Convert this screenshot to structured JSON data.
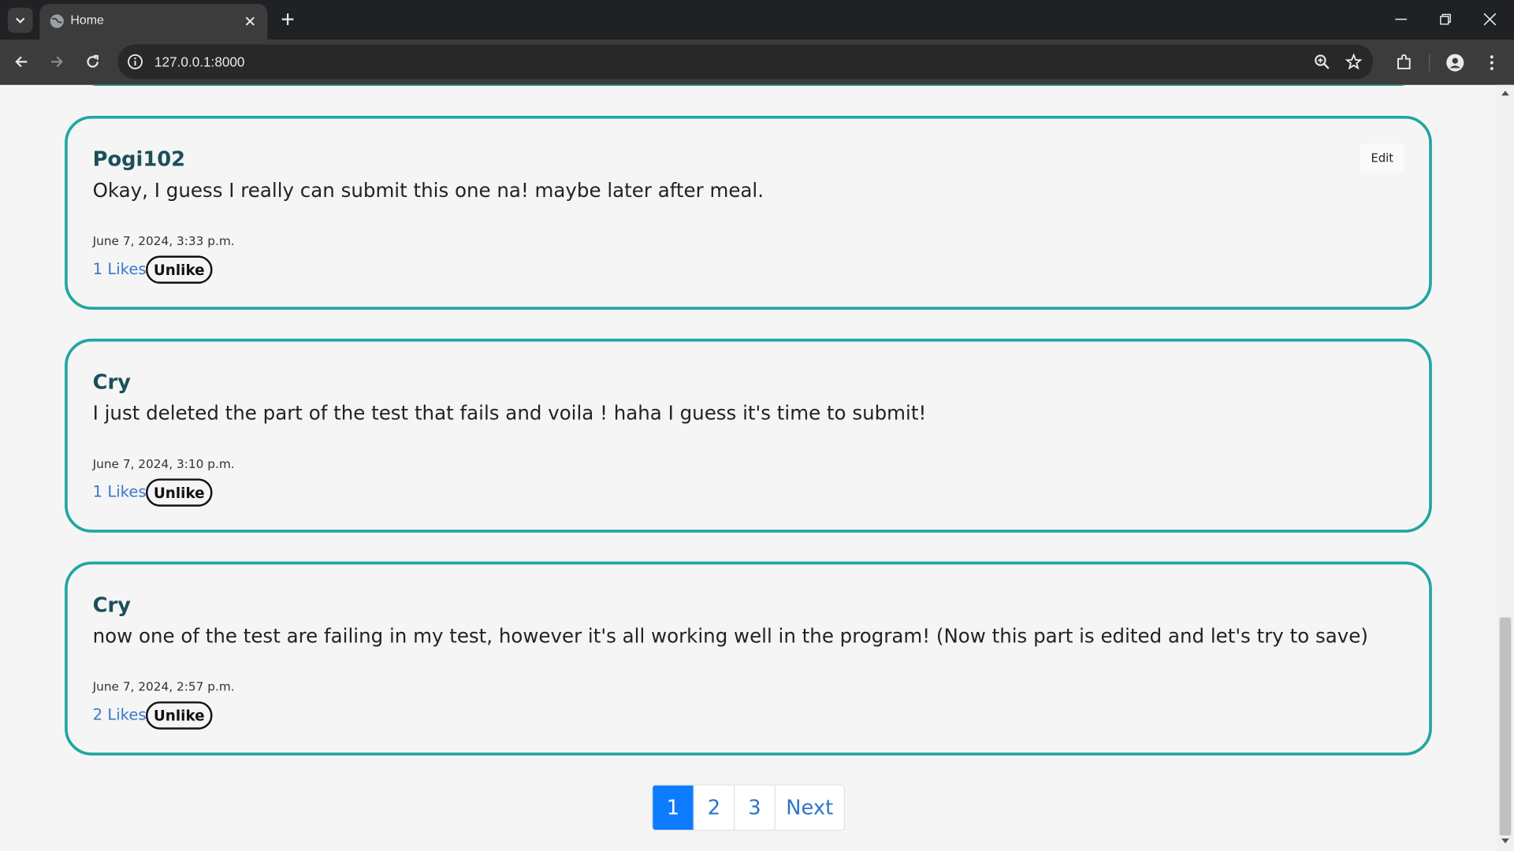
{
  "browser": {
    "tab_title": "Home",
    "url": "127.0.0.1:8000"
  },
  "posts": [
    {
      "author": "Pogi102",
      "body": "Okay, I guess I really can submit this one na! maybe later after meal.",
      "date": "June 7, 2024, 3:33 p.m.",
      "likes": "1 Likes",
      "unlike_label": "Unlike",
      "edit_label": "Edit"
    },
    {
      "author": "Cry",
      "body": "I just deleted the part of the test that fails and voila ! haha I guess it's time to submit!",
      "date": "June 7, 2024, 3:10 p.m.",
      "likes": "1 Likes",
      "unlike_label": "Unlike"
    },
    {
      "author": "Cry",
      "body": "now one of the test are failing in my test, however it's all working well in the program! (Now this part is edited and let's try to save)",
      "date": "June 7, 2024, 2:57 p.m.",
      "likes": "2 Likes",
      "unlike_label": "Unlike"
    }
  ],
  "pagination": {
    "pages": [
      "1",
      "2",
      "3"
    ],
    "next_label": "Next",
    "active_page": "1"
  },
  "colors": {
    "card_border": "#20a6a3",
    "author": "#1b4f5a",
    "link": "#3a78c9",
    "active_page": "#0d7bfd"
  }
}
